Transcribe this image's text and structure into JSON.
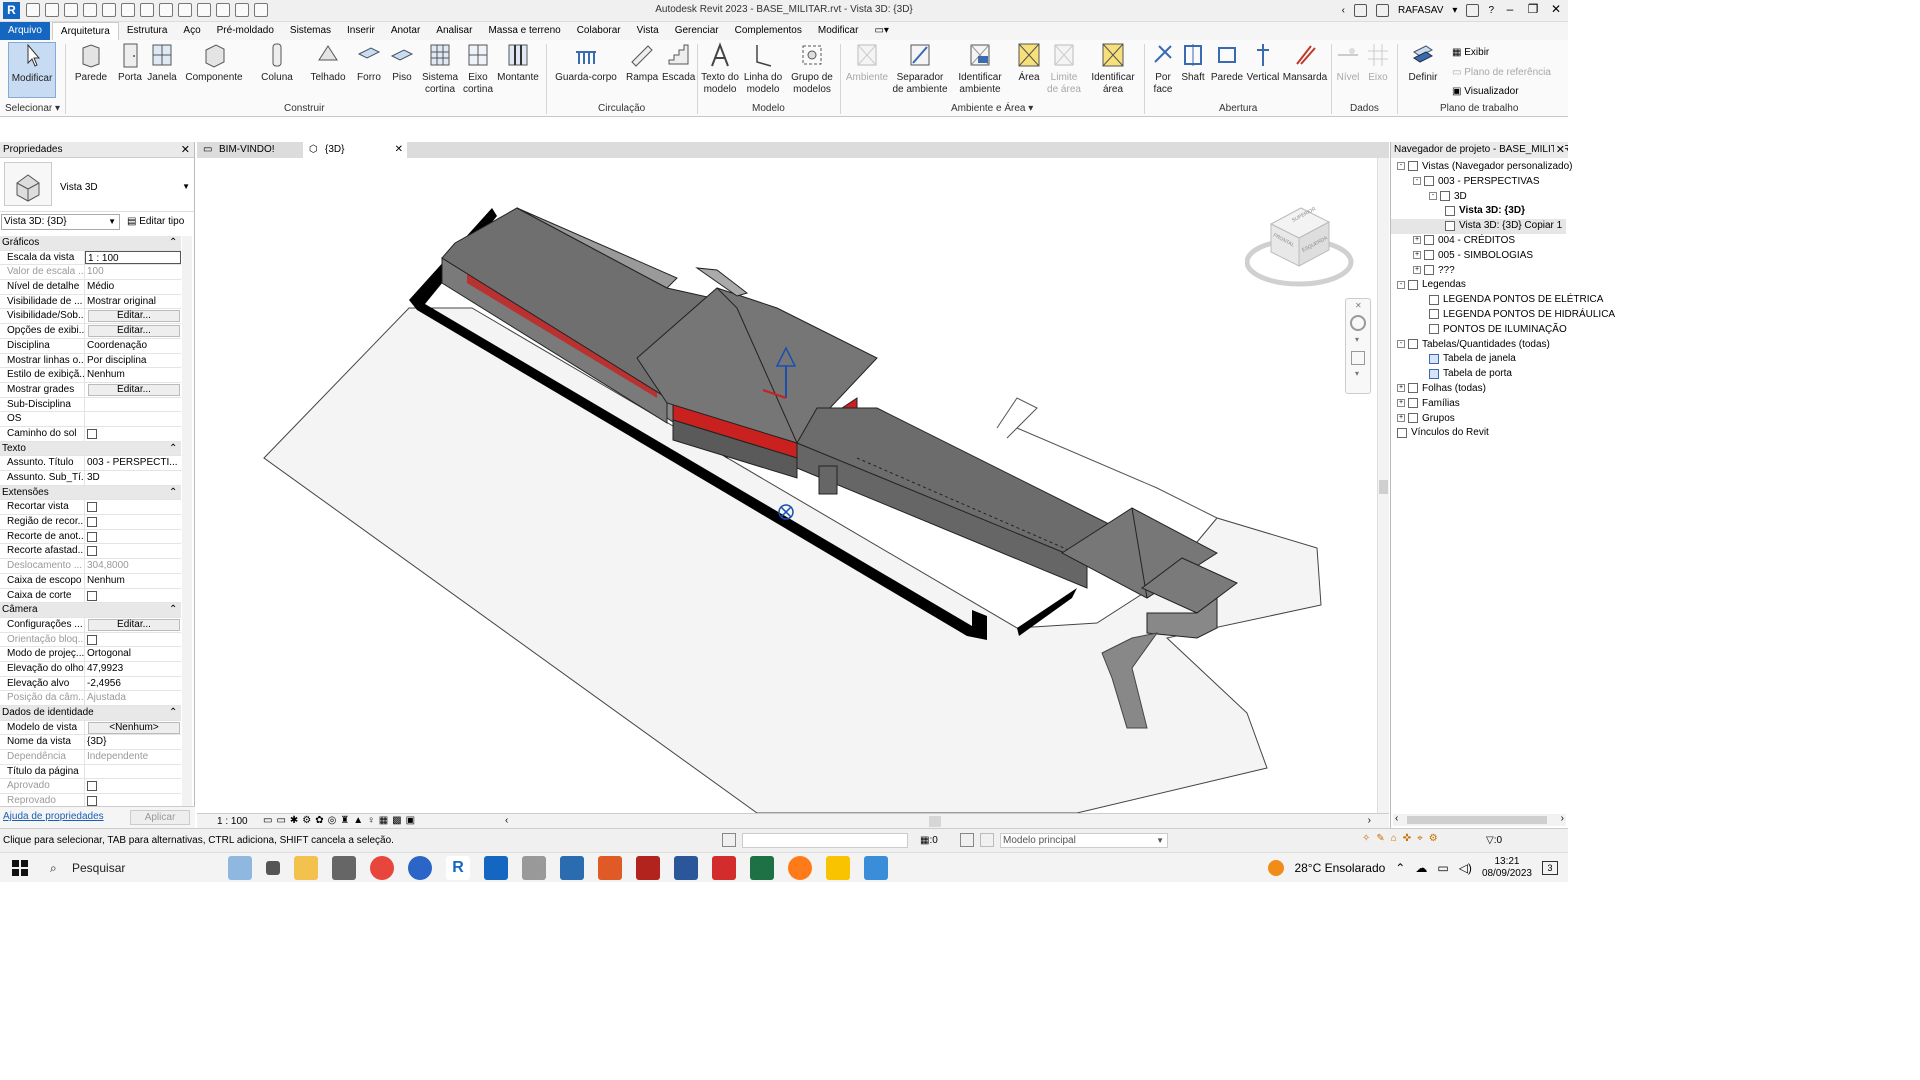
{
  "app": {
    "logo": "R",
    "title": "Autodesk Revit 2023 - BASE_MILITAR.rvt - Vista 3D: {3D}",
    "user": "RAFASAV"
  },
  "menu_tabs": [
    "Arquivo",
    "Arquitetura",
    "Estrutura",
    "Aço",
    "Pré-moldado",
    "Sistemas",
    "Inserir",
    "Anotar",
    "Analisar",
    "Massa e terreno",
    "Colaborar",
    "Vista",
    "Gerenciar",
    "Complementos",
    "Modificar"
  ],
  "active_tab": "Arquitetura",
  "ribbon": {
    "buttons": {
      "modificar": "Modificar",
      "parede": "Parede",
      "porta": "Porta",
      "janela": "Janela",
      "componente": "Componente",
      "coluna": "Coluna",
      "telhado": "Telhado",
      "forro": "Forro",
      "piso": "Piso",
      "sistema_cortina_1": "Sistema",
      "sistema_cortina_2": "cortina",
      "eixo_cortina_1": "Eixo",
      "eixo_cortina_2": "cortina",
      "montante": "Montante",
      "guarda_corpo": "Guarda-corpo",
      "rampa": "Rampa",
      "escada": "Escada",
      "texto_modelo_1": "Texto do",
      "texto_modelo_2": "modelo",
      "linha_modelo_1": "Linha do",
      "linha_modelo_2": "modelo",
      "grupo_modelos_1": "Grupo de",
      "grupo_modelos_2": "modelos",
      "ambiente": "Ambiente",
      "separador_1": "Separador",
      "separador_2": "de ambiente",
      "ident_ambiente_1": "Identificar",
      "ident_ambiente_2": "ambiente",
      "area": "Área",
      "limite_area_1": "Limite",
      "limite_area_2": "de área",
      "ident_area_1": "Identificar",
      "ident_area_2": "área",
      "por_face_1": "Por",
      "por_face_2": "face",
      "shaft": "Shaft",
      "parede_ab": "Parede",
      "vertical": "Vertical",
      "mansarda": "Mansarda",
      "nivel": "Nível",
      "eixo": "Eixo",
      "definir": "Definir",
      "exibir": "Exibir",
      "plano_ref": "Plano de referência",
      "visualizador": "Visualizador"
    },
    "panels": {
      "selecionar": "Selecionar",
      "construir": "Construir",
      "circulacao": "Circulação",
      "modelo": "Modelo",
      "ambiente_area": "Ambiente e Área",
      "abertura": "Abertura",
      "dados": "Dados",
      "plano_trabalho": "Plano de trabalho"
    }
  },
  "properties": {
    "title": "Propriedades",
    "type_name": "Vista 3D",
    "selector": "Vista 3D: {3D}",
    "edit_type": "Editar tipo",
    "rows": [
      {
        "k": "Gráficos",
        "group": true
      },
      {
        "k": "Escala da vista",
        "v": "1 : 100",
        "field": true
      },
      {
        "k": "Valor de escala ...",
        "v": "100",
        "dim": true
      },
      {
        "k": "Nível de detalhe",
        "v": "Médio"
      },
      {
        "k": "Visibilidade de ...",
        "v": "Mostrar original"
      },
      {
        "k": "Visibilidade/Sob...",
        "v": "Editar...",
        "btn": true
      },
      {
        "k": "Opções de exibi...",
        "v": "Editar...",
        "btn": true
      },
      {
        "k": "Disciplina",
        "v": "Coordenação"
      },
      {
        "k": "Mostrar linhas o...",
        "v": "Por disciplina"
      },
      {
        "k": "Estilo de exibiçã...",
        "v": "Nenhum"
      },
      {
        "k": "Mostrar grades",
        "v": "Editar...",
        "btn": true
      },
      {
        "k": "Sub-Disciplina",
        "v": ""
      },
      {
        "k": "OS",
        "v": ""
      },
      {
        "k": "Caminho do sol",
        "v": "",
        "chk": true
      },
      {
        "k": "Texto",
        "group": true
      },
      {
        "k": "Assunto. Título",
        "v": "003 - PERSPECTI..."
      },
      {
        "k": "Assunto. Sub_Tí...",
        "v": "3D"
      },
      {
        "k": "Extensões",
        "group": true
      },
      {
        "k": "Recortar vista",
        "v": "",
        "chk": true
      },
      {
        "k": "Região de recor...",
        "v": "",
        "chk": true
      },
      {
        "k": "Recorte de anot...",
        "v": "",
        "chk": true
      },
      {
        "k": "Recorte afastad...",
        "v": "",
        "chk": true
      },
      {
        "k": "Deslocamento ...",
        "v": "304,8000",
        "dim": true
      },
      {
        "k": "Caixa de escopo",
        "v": "Nenhum"
      },
      {
        "k": "Caixa de corte",
        "v": "",
        "chk": true
      },
      {
        "k": "Câmera",
        "group": true
      },
      {
        "k": "Configurações ...",
        "v": "Editar...",
        "btn": true
      },
      {
        "k": "Orientação bloq...",
        "v": "",
        "chk": true,
        "dim": true
      },
      {
        "k": "Modo de projeç...",
        "v": "Ortogonal"
      },
      {
        "k": "Elevação do olho",
        "v": "47,9923"
      },
      {
        "k": "Elevação alvo",
        "v": "-2,4956"
      },
      {
        "k": "Posição da câm...",
        "v": "Ajustada",
        "dim": true
      },
      {
        "k": "Dados de identidade",
        "group": true
      },
      {
        "k": "Modelo de vista",
        "v": "<Nenhum>",
        "btn": true
      },
      {
        "k": "Nome da vista",
        "v": "{3D}"
      },
      {
        "k": "Dependência",
        "v": "Independente",
        "dim": true
      },
      {
        "k": "Título da página",
        "v": ""
      },
      {
        "k": "Aprovado",
        "v": "",
        "chk": true,
        "dim": true
      },
      {
        "k": "Reprovado",
        "v": "",
        "chk": true,
        "dim": true
      }
    ],
    "help_link": "Ajuda de propriedades",
    "apply": "Aplicar"
  },
  "view_tabs": [
    "BIM-VINDO!",
    "{3D}"
  ],
  "view_scale": "1 : 100",
  "project_browser": {
    "title": "Navegador de projeto - BASE_MILITAR.rvt",
    "nodes": [
      {
        "label": "Vistas (Navegador personalizado)",
        "level": 0,
        "exp": "-"
      },
      {
        "label": "003 - PERSPECTIVAS",
        "level": 1,
        "exp": "-"
      },
      {
        "label": "3D",
        "level": 2,
        "exp": "-"
      },
      {
        "label": "Vista 3D: {3D}",
        "level": 3,
        "bold": true
      },
      {
        "label": "Vista 3D: {3D} Copiar 1",
        "level": 3,
        "hl": true
      },
      {
        "label": "004 - CRÉDITOS",
        "level": 1,
        "exp": "+"
      },
      {
        "label": "005 - SIMBOLOGIAS",
        "level": 1,
        "exp": "+"
      },
      {
        "label": "???",
        "level": 1,
        "exp": "+"
      },
      {
        "label": "Legendas",
        "level": 0,
        "exp": "-"
      },
      {
        "label": "LEGENDA PONTOS DE ELÉTRICA",
        "level": 2
      },
      {
        "label": "LEGENDA PONTOS DE HIDRÁULICA",
        "level": 2
      },
      {
        "label": "PONTOS DE ILUMINAÇÃO",
        "level": 2
      },
      {
        "label": "Tabelas/Quantidades (todas)",
        "level": 0,
        "exp": "-"
      },
      {
        "label": "Tabela de janela",
        "level": 2,
        "table": true
      },
      {
        "label": "Tabela de porta",
        "level": 2,
        "table": true
      },
      {
        "label": "Folhas (todas)",
        "level": 0,
        "exp": "+"
      },
      {
        "label": "Famílias",
        "level": 0,
        "exp": "+"
      },
      {
        "label": "Grupos",
        "level": 0,
        "exp": "+"
      },
      {
        "label": "Vínculos do Revit",
        "level": 0
      }
    ]
  },
  "viewcube": {
    "front": "FRONTAL",
    "right": "ESQUERDA",
    "top": "SUPERIOR"
  },
  "status": {
    "hint": "Clique para selecionar, TAB para alternativas, CTRL adiciona, SHIFT cancela a seleção.",
    "zero1": ":0",
    "model": "Modelo principal",
    "zero2": ":0"
  },
  "taskbar": {
    "search": "Pesquisar",
    "weather": "28°C  Ensolarado",
    "time": "13:21",
    "date": "08/09/2023",
    "notif": "3"
  }
}
